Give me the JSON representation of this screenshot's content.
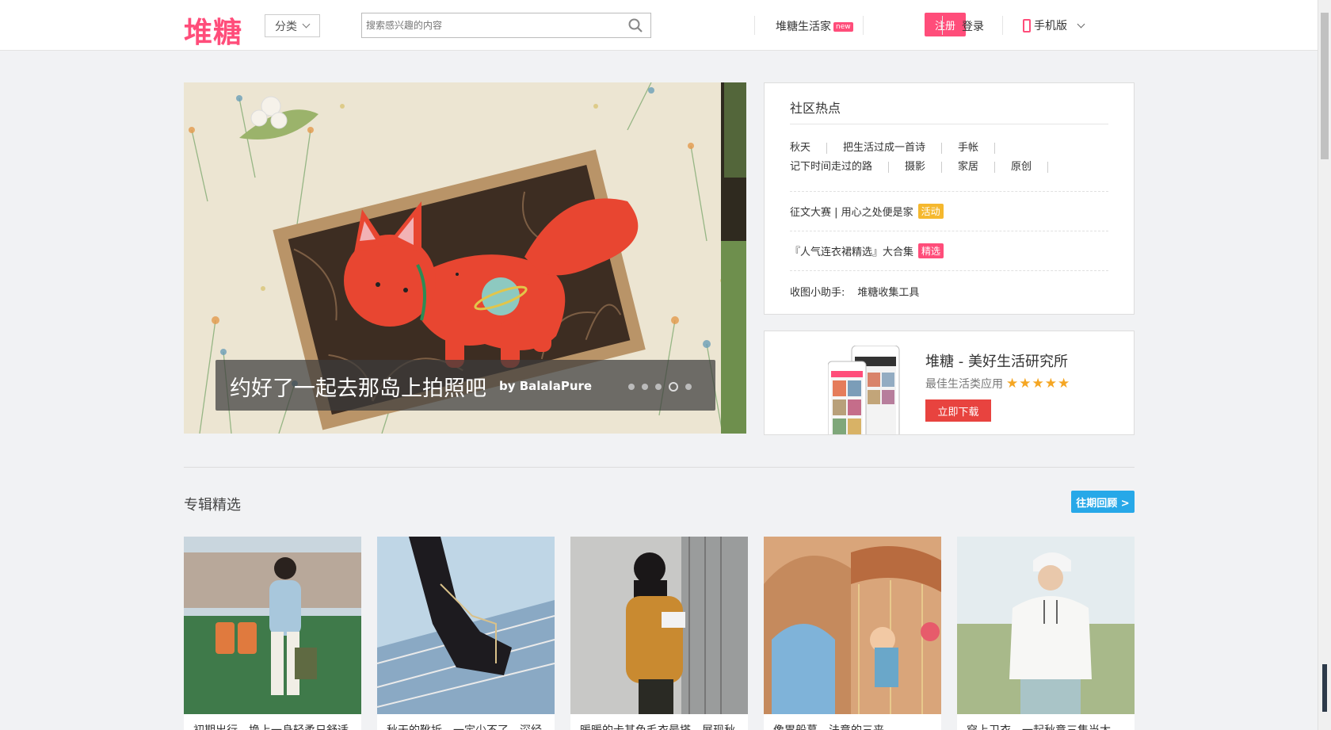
{
  "header": {
    "logo": "堆糖",
    "category_label": "分类",
    "search_placeholder": "搜索感兴趣的内容",
    "life_home": "堆糖生活家",
    "new_badge": "new",
    "register": "注册",
    "login": "登录",
    "mobile": "手机版"
  },
  "carousel": {
    "caption": "约好了一起去那岛上拍照吧",
    "author": "by BalalaPure",
    "dot_count": 5,
    "active_dot": 4
  },
  "hot": {
    "title": "社区热点",
    "tags": [
      "秋天",
      "把生活过成一首诗",
      "手帐",
      "记下时间走过的路",
      "摄影",
      "家居",
      "原创"
    ],
    "contest": "征文大赛 | 用心之处便是家",
    "contest_badge": "活动",
    "dress": "『人气连衣裙精选』大合集",
    "dress_badge": "精选",
    "helper_label": "收图小助手:",
    "helper_tool": "堆糖收集工具"
  },
  "app": {
    "name": "堆糖 - 美好生活研究所",
    "subtitle": "最佳生活类应用",
    "stars": "★★★★★",
    "download": "立即下载"
  },
  "section": {
    "title": "专辑精选",
    "past_button": "往期回顾 >"
  },
  "cards": [
    {
      "text": " 初期出行，换上一身轻柔日舒适"
    },
    {
      "text": " 秋天的靴拆，一定少不了，深经"
    },
    {
      "text": " 暖暖的卡其色毛衣最搭，展现秋"
    },
    {
      "text": " 像胃般慕，法意的三来"
    },
    {
      "text": " 穿上卫衣，一起秋意三集当太"
    }
  ],
  "colors": {
    "brand_pink": "#ff4d7a",
    "past_blue": "#27a8e8",
    "download_red": "#e8433f",
    "activity_yellow": "#f5b82e"
  }
}
